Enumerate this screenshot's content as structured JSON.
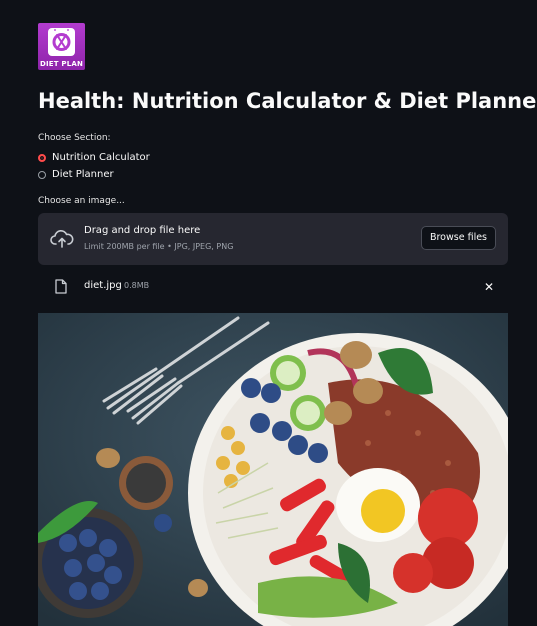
{
  "logo": {
    "text": "DIET PLAN"
  },
  "page": {
    "title": "Health: Nutrition Calculator & Diet Planner"
  },
  "section_selector": {
    "label": "Choose Section:",
    "options": [
      {
        "label": "Nutrition Calculator",
        "selected": true
      },
      {
        "label": "Diet Planner",
        "selected": false
      }
    ]
  },
  "uploader": {
    "label": "Choose an image...",
    "drop_title": "Drag and drop file here",
    "limit_text": "Limit 200MB per file • JPG, JPEG, PNG",
    "browse_label": "Browse files"
  },
  "uploaded_file": {
    "name": "diet.jpg",
    "size": "0.8MB",
    "remove_symbol": "✕"
  },
  "colors": {
    "background": "#0e1117",
    "accent": "#ff4b4b",
    "dropzone": "#262730"
  }
}
